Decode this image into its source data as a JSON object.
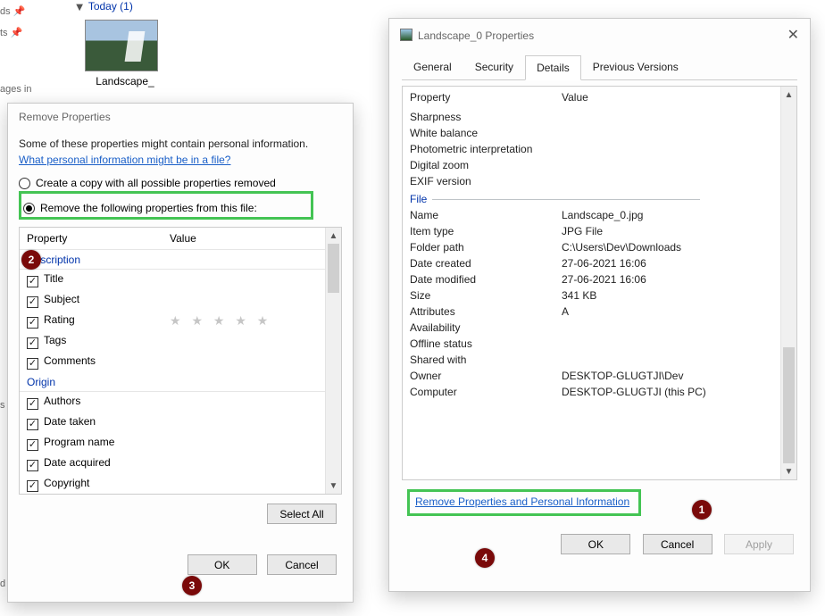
{
  "bg": {
    "fragments": [
      "ds",
      "ts",
      "ages in",
      "s",
      "d",
      "s"
    ],
    "group_label": "Today (1)",
    "thumb_label": "Landscape_"
  },
  "remove_dialog": {
    "title": "Remove Properties",
    "intro": "Some of these properties might contain personal information.",
    "info_link": "What personal information might be in a file?",
    "radio_copy": "Create a copy with all possible properties removed",
    "radio_remove": "Remove the following properties from this file:",
    "col_property": "Property",
    "col_value": "Value",
    "section_description": "Description",
    "desc_items": [
      "Title",
      "Subject",
      "Rating",
      "Tags",
      "Comments"
    ],
    "section_origin": "Origin",
    "origin_items": [
      "Authors",
      "Date taken",
      "Program name",
      "Date acquired",
      "Copyright"
    ],
    "select_all": "Select All",
    "ok": "OK",
    "cancel": "Cancel"
  },
  "props_dialog": {
    "title": "Landscape_0 Properties",
    "tabs": {
      "general": "General",
      "security": "Security",
      "details": "Details",
      "prev": "Previous Versions"
    },
    "col_property": "Property",
    "col_value": "Value",
    "top_rows": [
      "Sharpness",
      "White balance",
      "Photometric interpretation",
      "Digital zoom",
      "EXIF version"
    ],
    "section_file": "File",
    "file_rows": [
      {
        "k": "Name",
        "v": "Landscape_0.jpg"
      },
      {
        "k": "Item type",
        "v": "JPG File"
      },
      {
        "k": "Folder path",
        "v": "C:\\Users\\Dev\\Downloads"
      },
      {
        "k": "Date created",
        "v": "27-06-2021 16:06"
      },
      {
        "k": "Date modified",
        "v": "27-06-2021 16:06"
      },
      {
        "k": "Size",
        "v": "341 KB"
      },
      {
        "k": "Attributes",
        "v": "A"
      },
      {
        "k": "Availability",
        "v": ""
      },
      {
        "k": "Offline status",
        "v": ""
      },
      {
        "k": "Shared with",
        "v": ""
      },
      {
        "k": "Owner",
        "v": "DESKTOP-GLUGTJI\\Dev"
      },
      {
        "k": "Computer",
        "v": "DESKTOP-GLUGTJI (this PC)"
      }
    ],
    "remove_link": "Remove Properties and Personal Information",
    "ok": "OK",
    "cancel": "Cancel",
    "apply": "Apply"
  },
  "annotations": {
    "a1": "1",
    "a2": "2",
    "a3": "3",
    "a4": "4"
  }
}
